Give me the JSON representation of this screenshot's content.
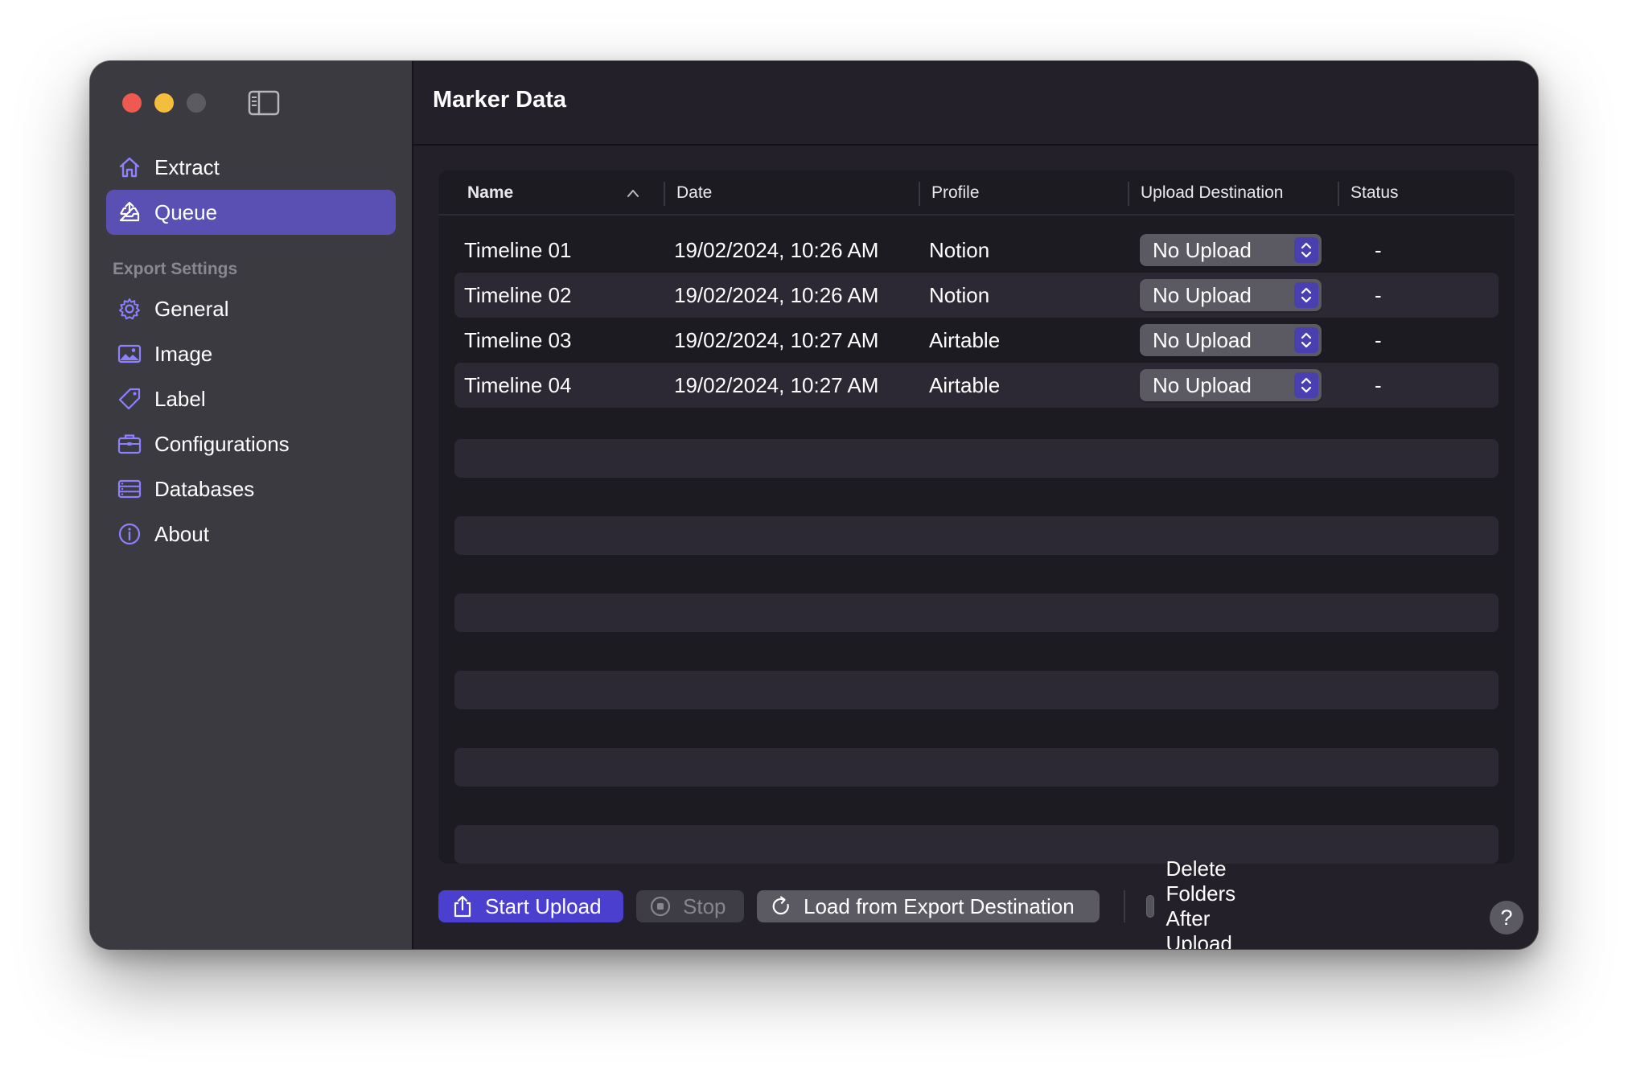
{
  "window": {
    "title": "Marker Data"
  },
  "sidebar": {
    "nav": [
      {
        "label": "Extract",
        "icon": "house-icon"
      },
      {
        "label": "Queue",
        "icon": "tray-upload-icon",
        "active": true
      }
    ],
    "section_label": "Export Settings",
    "settings": [
      {
        "label": "General",
        "icon": "gear-icon"
      },
      {
        "label": "Image",
        "icon": "photo-icon"
      },
      {
        "label": "Label",
        "icon": "tag-icon"
      },
      {
        "label": "Configurations",
        "icon": "briefcase-icon"
      },
      {
        "label": "Databases",
        "icon": "server-rack-icon"
      },
      {
        "label": "About",
        "icon": "info-circle-icon"
      }
    ]
  },
  "table": {
    "columns": [
      "Name",
      "Date",
      "Profile",
      "Upload Destination",
      "Status"
    ],
    "rows": [
      {
        "name": "Timeline 01",
        "date": "19/02/2024, 10:26 AM",
        "profile": "Notion",
        "destination": "No Upload",
        "status": "-"
      },
      {
        "name": "Timeline 02",
        "date": "19/02/2024, 10:26 AM",
        "profile": "Notion",
        "destination": "No Upload",
        "status": "-"
      },
      {
        "name": "Timeline 03",
        "date": "19/02/2024, 10:27 AM",
        "profile": "Airtable",
        "destination": "No Upload",
        "status": "-"
      },
      {
        "name": "Timeline 04",
        "date": "19/02/2024, 10:27 AM",
        "profile": "Airtable",
        "destination": "No Upload",
        "status": "-"
      }
    ]
  },
  "actions": {
    "start_upload": "Start Upload",
    "stop": "Stop",
    "load_from_export": "Load from Export Destination",
    "delete_folders": "Delete Folders After Upload",
    "delete_folders_checked": false,
    "help": "?"
  },
  "colors": {
    "accent": "#5a4fb3",
    "primary_button": "#4b3fcf",
    "sidebar_icon": "#8c80ff"
  }
}
